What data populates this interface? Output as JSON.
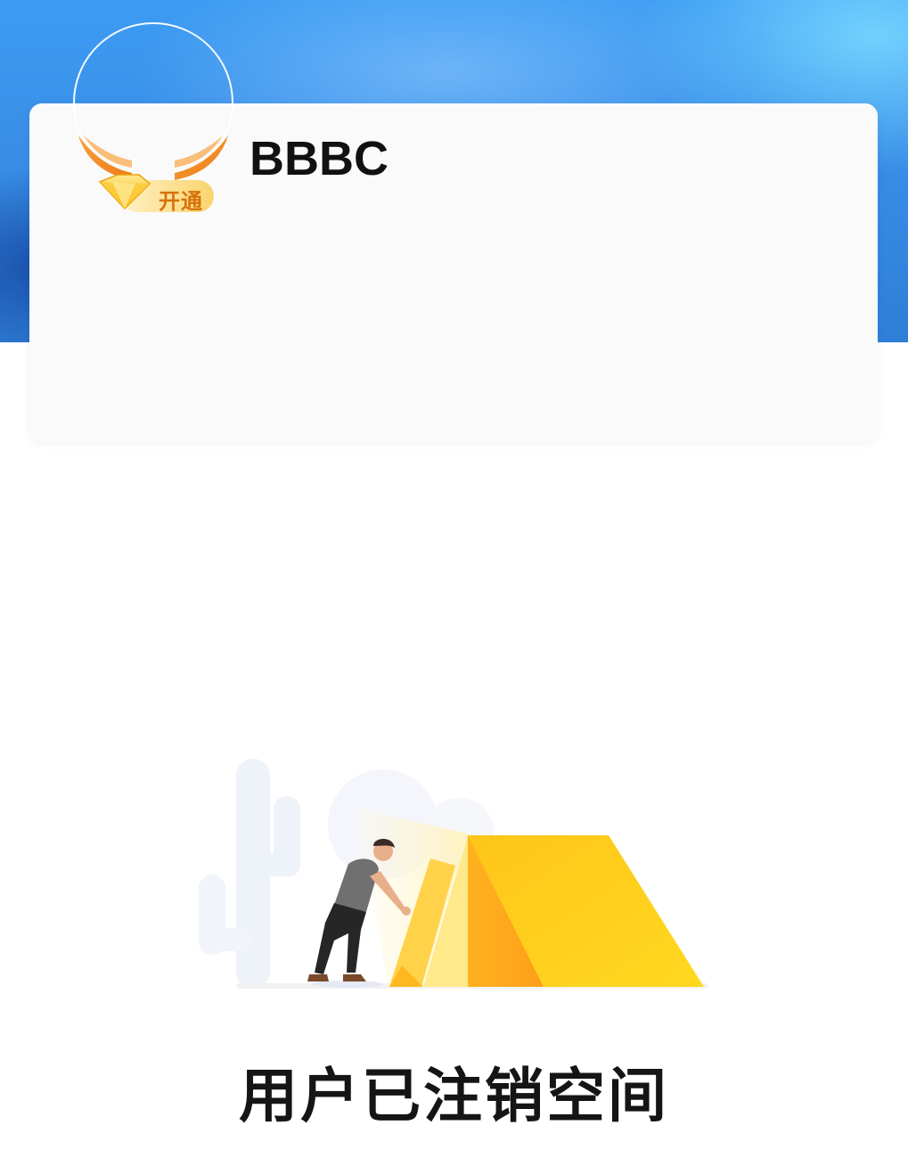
{
  "header": {
    "vip_badge_label": "开通",
    "vip_badge_icon": "diamond-icon"
  },
  "profile": {
    "username": "BBBC"
  },
  "empty_state": {
    "illustration": "tent-camping-illustration",
    "message": "用户已注销空间"
  },
  "colors": {
    "header_blue": "#3a8fe8",
    "card_bg": "#fafafa",
    "tent_yellow": "#ffcf1a",
    "badge_orange": "#f5941f"
  }
}
